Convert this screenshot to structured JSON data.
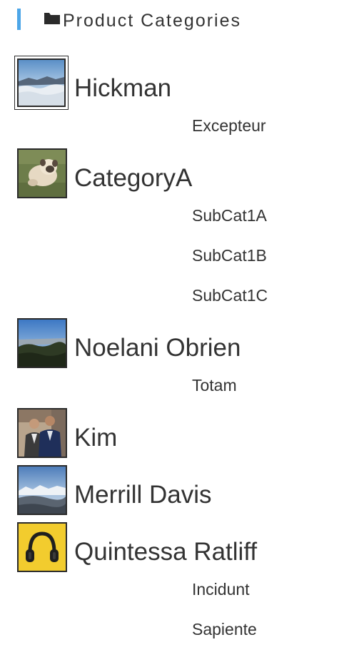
{
  "header": {
    "title": "Product Categories",
    "icon": "folder-icon",
    "accent_color": "#4da6e8"
  },
  "categories": [
    {
      "name": "Hickman",
      "image": "mountain-clouds",
      "selected": true,
      "subcategories": [
        "Excepteur"
      ]
    },
    {
      "name": "CategoryA",
      "image": "pug-on-grass",
      "subcategories": [
        "SubCat1A",
        "SubCat1B",
        "SubCat1C"
      ]
    },
    {
      "name": "Noelani Obrien",
      "image": "forest-horizon",
      "subcategories": [
        "Totam"
      ]
    },
    {
      "name": "Kim",
      "image": "two-men-portrait",
      "subcategories": []
    },
    {
      "name": "Merrill Davis",
      "image": "mountain-valley",
      "subcategories": []
    },
    {
      "name": "Quintessa Ratliff",
      "image": "headphones-yellow",
      "subcategories": [
        "Incidunt",
        "Sapiente"
      ]
    }
  ]
}
